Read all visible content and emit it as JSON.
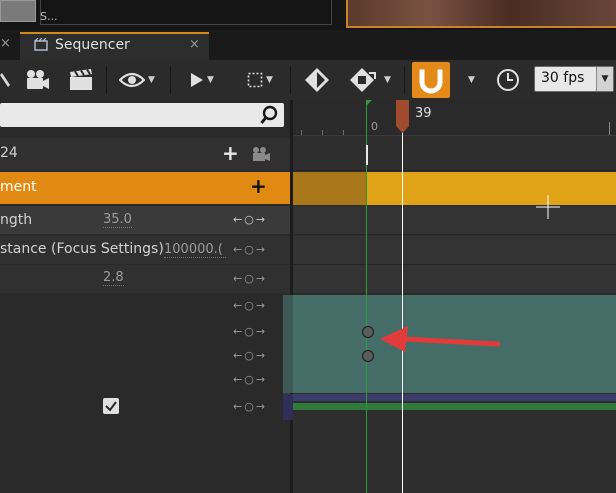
{
  "top": {
    "thumb_label": "S..."
  },
  "tab": {
    "title": "Sequencer",
    "close": "×",
    "left_close": "×"
  },
  "toolbar": {
    "fps_value": "30 fps",
    "accent": "#e38a18"
  },
  "search": {
    "placeholder": ""
  },
  "tracks": [
    {
      "label": "24",
      "icons": [
        "add-icon",
        "camera-icon"
      ]
    },
    {
      "label": "ment",
      "icons": [
        "add-icon"
      ]
    },
    {
      "label": "ngth",
      "value": "35.0",
      "key_ctrl": "←○→"
    },
    {
      "label": "stance (Focus Settings)",
      "value": "100000.(",
      "key_ctrl": "←○→"
    },
    {
      "label": "",
      "value": "2.8",
      "key_ctrl": "←○→"
    },
    {
      "label": "",
      "value": "",
      "key_ctrl": "←○→"
    },
    {
      "label": "",
      "value": "",
      "key_ctrl": "←○→"
    },
    {
      "label": "",
      "value": "",
      "key_ctrl": "←○→"
    },
    {
      "label": "",
      "value": "",
      "key_ctrl": "←○→"
    },
    {
      "label": "",
      "value": "",
      "key_ctrl": "←○→"
    }
  ],
  "timeline": {
    "start_frame": "0",
    "current_frame": "39"
  },
  "colors": {
    "track_orange": "#e08a14",
    "timeline_orange": "#e0a318",
    "section_teal": "#456d68",
    "arrow_red": "#e23b3b"
  }
}
